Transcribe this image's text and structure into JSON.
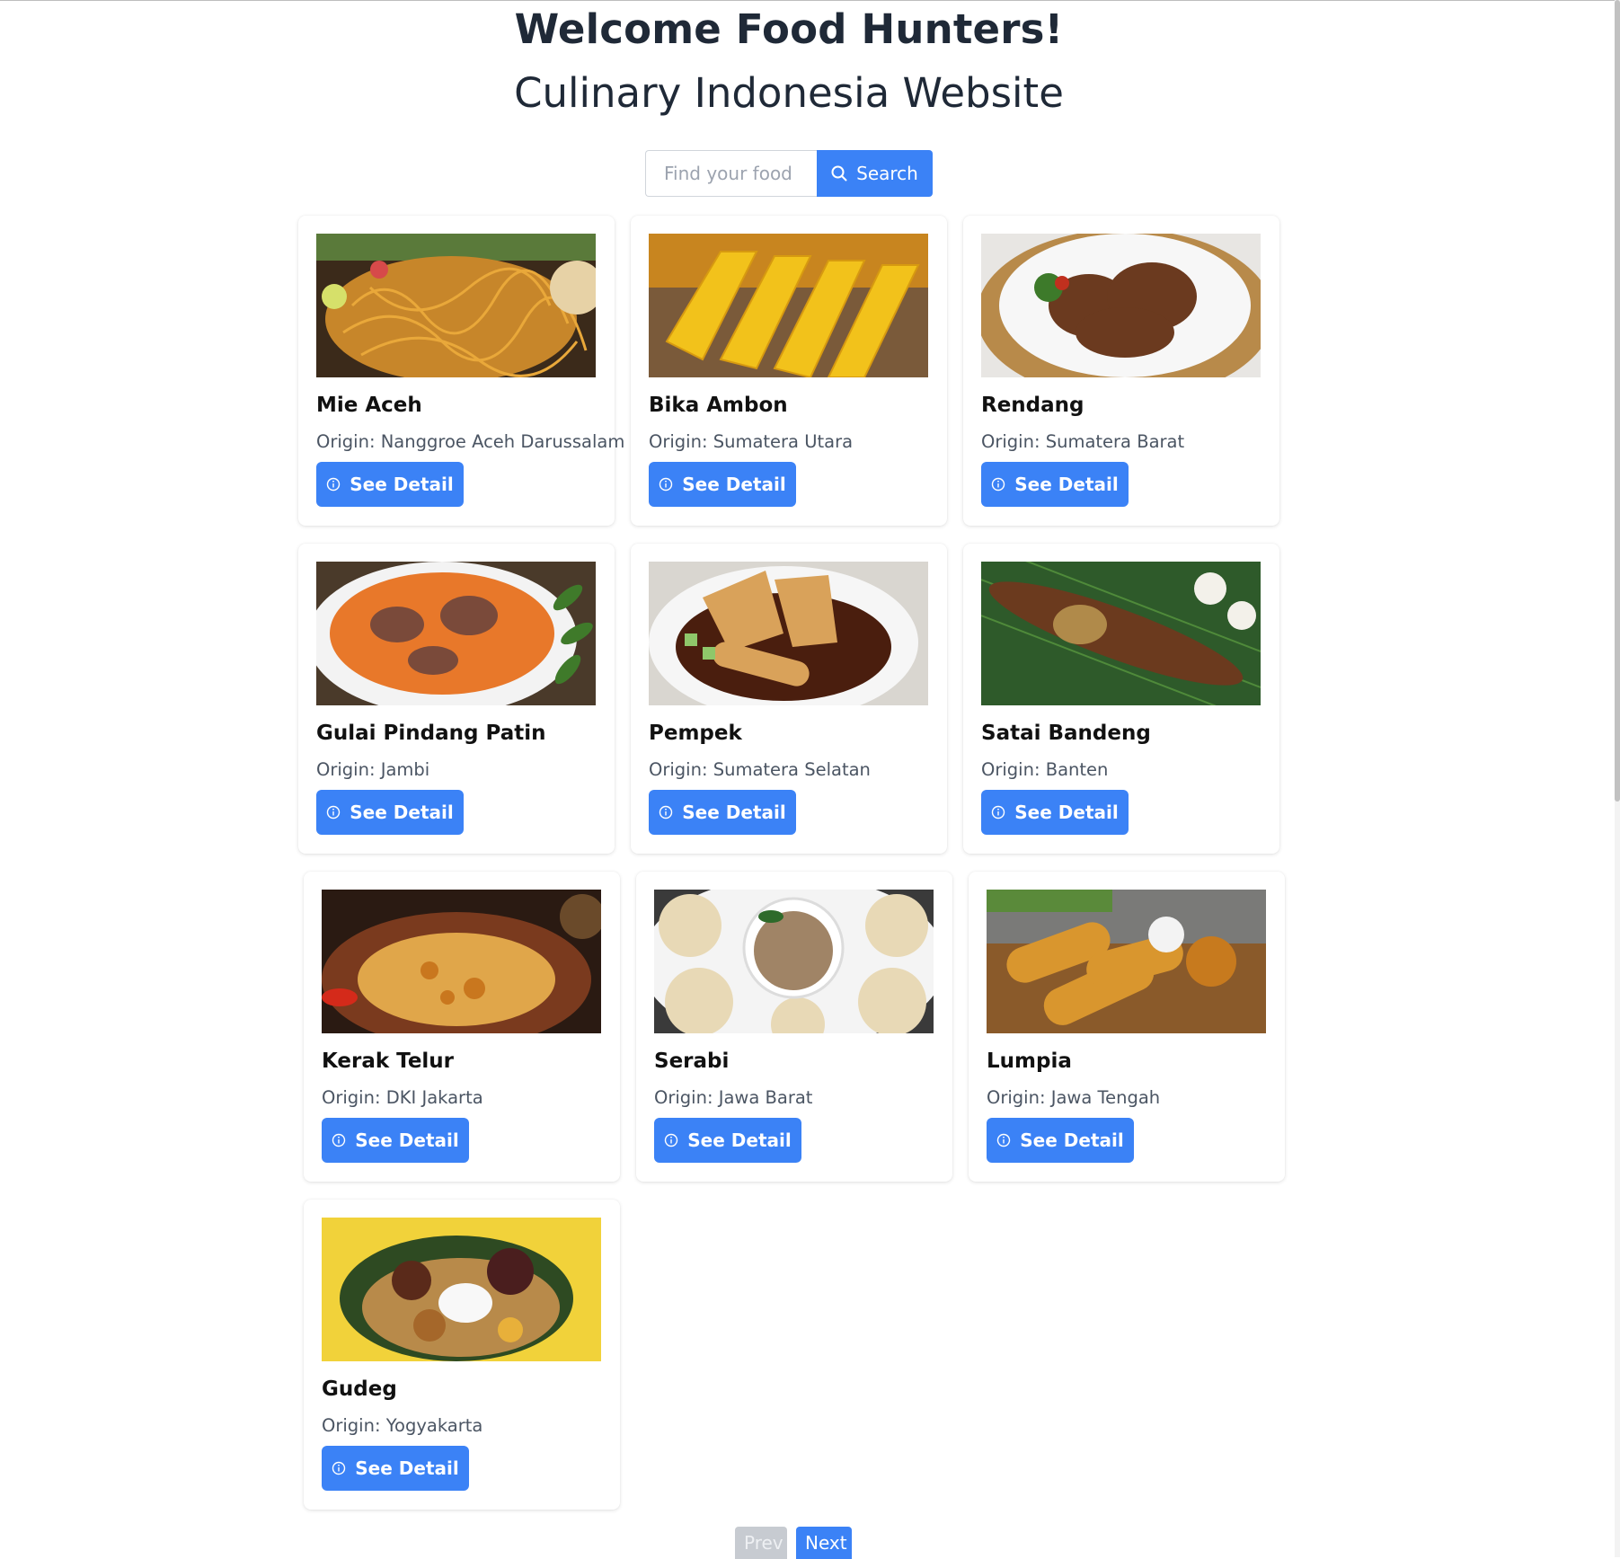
{
  "header": {
    "title": "Welcome Food Hunters!",
    "subtitle": "Culinary Indonesia Website"
  },
  "search": {
    "placeholder": "Find your food",
    "value": "",
    "button_label": "Search",
    "button_icon": "search-icon"
  },
  "cards": [
    {
      "name": "Mie Aceh",
      "origin": "Origin: Nanggroe Aceh Darussalam",
      "button": "See Detail",
      "image": "mie-aceh-photo"
    },
    {
      "name": "Bika Ambon",
      "origin": "Origin: Sumatera Utara",
      "button": "See Detail",
      "image": "bika-ambon-photo"
    },
    {
      "name": "Rendang",
      "origin": "Origin: Sumatera Barat",
      "button": "See Detail",
      "image": "rendang-photo"
    },
    {
      "name": "Gulai Pindang Patin",
      "origin": "Origin: Jambi",
      "button": "See Detail",
      "image": "gulai-pindang-patin-photo"
    },
    {
      "name": "Pempek",
      "origin": "Origin: Sumatera Selatan",
      "button": "See Detail",
      "image": "pempek-photo"
    },
    {
      "name": "Satai Bandeng",
      "origin": "Origin: Banten",
      "button": "See Detail",
      "image": "satai-bandeng-photo"
    },
    {
      "name": "Kerak Telur",
      "origin": "Origin: DKI Jakarta",
      "button": "See Detail",
      "image": "kerak-telur-photo"
    },
    {
      "name": "Serabi",
      "origin": "Origin: Jawa Barat",
      "button": "See Detail",
      "image": "serabi-photo"
    },
    {
      "name": "Lumpia",
      "origin": "Origin: Jawa Tengah",
      "button": "See Detail",
      "image": "lumpia-photo"
    },
    {
      "name": "Gudeg",
      "origin": "Origin: Yogyakarta",
      "button": "See Detail",
      "image": "gudeg-photo"
    }
  ],
  "pagination": {
    "prev_label": "Prev",
    "next_label": "Next",
    "prev_disabled": true
  },
  "colors": {
    "accent": "#3b82f6",
    "disabled": "#c7cbd1",
    "title_text": "#1f2937",
    "muted_text": "#4b5563"
  }
}
